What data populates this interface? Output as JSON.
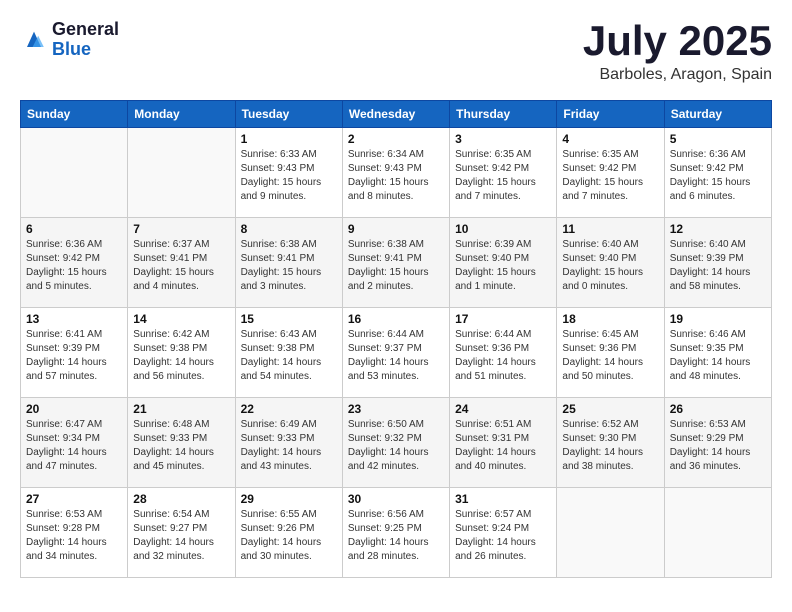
{
  "header": {
    "logo_general": "General",
    "logo_blue": "Blue",
    "month": "July 2025",
    "location": "Barboles, Aragon, Spain"
  },
  "days_of_week": [
    "Sunday",
    "Monday",
    "Tuesday",
    "Wednesday",
    "Thursday",
    "Friday",
    "Saturday"
  ],
  "weeks": [
    [
      {
        "day": "",
        "sunrise": "",
        "sunset": "",
        "daylight": ""
      },
      {
        "day": "",
        "sunrise": "",
        "sunset": "",
        "daylight": ""
      },
      {
        "day": "1",
        "sunrise": "Sunrise: 6:33 AM",
        "sunset": "Sunset: 9:43 PM",
        "daylight": "Daylight: 15 hours and 9 minutes."
      },
      {
        "day": "2",
        "sunrise": "Sunrise: 6:34 AM",
        "sunset": "Sunset: 9:43 PM",
        "daylight": "Daylight: 15 hours and 8 minutes."
      },
      {
        "day": "3",
        "sunrise": "Sunrise: 6:35 AM",
        "sunset": "Sunset: 9:42 PM",
        "daylight": "Daylight: 15 hours and 7 minutes."
      },
      {
        "day": "4",
        "sunrise": "Sunrise: 6:35 AM",
        "sunset": "Sunset: 9:42 PM",
        "daylight": "Daylight: 15 hours and 7 minutes."
      },
      {
        "day": "5",
        "sunrise": "Sunrise: 6:36 AM",
        "sunset": "Sunset: 9:42 PM",
        "daylight": "Daylight: 15 hours and 6 minutes."
      }
    ],
    [
      {
        "day": "6",
        "sunrise": "Sunrise: 6:36 AM",
        "sunset": "Sunset: 9:42 PM",
        "daylight": "Daylight: 15 hours and 5 minutes."
      },
      {
        "day": "7",
        "sunrise": "Sunrise: 6:37 AM",
        "sunset": "Sunset: 9:41 PM",
        "daylight": "Daylight: 15 hours and 4 minutes."
      },
      {
        "day": "8",
        "sunrise": "Sunrise: 6:38 AM",
        "sunset": "Sunset: 9:41 PM",
        "daylight": "Daylight: 15 hours and 3 minutes."
      },
      {
        "day": "9",
        "sunrise": "Sunrise: 6:38 AM",
        "sunset": "Sunset: 9:41 PM",
        "daylight": "Daylight: 15 hours and 2 minutes."
      },
      {
        "day": "10",
        "sunrise": "Sunrise: 6:39 AM",
        "sunset": "Sunset: 9:40 PM",
        "daylight": "Daylight: 15 hours and 1 minute."
      },
      {
        "day": "11",
        "sunrise": "Sunrise: 6:40 AM",
        "sunset": "Sunset: 9:40 PM",
        "daylight": "Daylight: 15 hours and 0 minutes."
      },
      {
        "day": "12",
        "sunrise": "Sunrise: 6:40 AM",
        "sunset": "Sunset: 9:39 PM",
        "daylight": "Daylight: 14 hours and 58 minutes."
      }
    ],
    [
      {
        "day": "13",
        "sunrise": "Sunrise: 6:41 AM",
        "sunset": "Sunset: 9:39 PM",
        "daylight": "Daylight: 14 hours and 57 minutes."
      },
      {
        "day": "14",
        "sunrise": "Sunrise: 6:42 AM",
        "sunset": "Sunset: 9:38 PM",
        "daylight": "Daylight: 14 hours and 56 minutes."
      },
      {
        "day": "15",
        "sunrise": "Sunrise: 6:43 AM",
        "sunset": "Sunset: 9:38 PM",
        "daylight": "Daylight: 14 hours and 54 minutes."
      },
      {
        "day": "16",
        "sunrise": "Sunrise: 6:44 AM",
        "sunset": "Sunset: 9:37 PM",
        "daylight": "Daylight: 14 hours and 53 minutes."
      },
      {
        "day": "17",
        "sunrise": "Sunrise: 6:44 AM",
        "sunset": "Sunset: 9:36 PM",
        "daylight": "Daylight: 14 hours and 51 minutes."
      },
      {
        "day": "18",
        "sunrise": "Sunrise: 6:45 AM",
        "sunset": "Sunset: 9:36 PM",
        "daylight": "Daylight: 14 hours and 50 minutes."
      },
      {
        "day": "19",
        "sunrise": "Sunrise: 6:46 AM",
        "sunset": "Sunset: 9:35 PM",
        "daylight": "Daylight: 14 hours and 48 minutes."
      }
    ],
    [
      {
        "day": "20",
        "sunrise": "Sunrise: 6:47 AM",
        "sunset": "Sunset: 9:34 PM",
        "daylight": "Daylight: 14 hours and 47 minutes."
      },
      {
        "day": "21",
        "sunrise": "Sunrise: 6:48 AM",
        "sunset": "Sunset: 9:33 PM",
        "daylight": "Daylight: 14 hours and 45 minutes."
      },
      {
        "day": "22",
        "sunrise": "Sunrise: 6:49 AM",
        "sunset": "Sunset: 9:33 PM",
        "daylight": "Daylight: 14 hours and 43 minutes."
      },
      {
        "day": "23",
        "sunrise": "Sunrise: 6:50 AM",
        "sunset": "Sunset: 9:32 PM",
        "daylight": "Daylight: 14 hours and 42 minutes."
      },
      {
        "day": "24",
        "sunrise": "Sunrise: 6:51 AM",
        "sunset": "Sunset: 9:31 PM",
        "daylight": "Daylight: 14 hours and 40 minutes."
      },
      {
        "day": "25",
        "sunrise": "Sunrise: 6:52 AM",
        "sunset": "Sunset: 9:30 PM",
        "daylight": "Daylight: 14 hours and 38 minutes."
      },
      {
        "day": "26",
        "sunrise": "Sunrise: 6:53 AM",
        "sunset": "Sunset: 9:29 PM",
        "daylight": "Daylight: 14 hours and 36 minutes."
      }
    ],
    [
      {
        "day": "27",
        "sunrise": "Sunrise: 6:53 AM",
        "sunset": "Sunset: 9:28 PM",
        "daylight": "Daylight: 14 hours and 34 minutes."
      },
      {
        "day": "28",
        "sunrise": "Sunrise: 6:54 AM",
        "sunset": "Sunset: 9:27 PM",
        "daylight": "Daylight: 14 hours and 32 minutes."
      },
      {
        "day": "29",
        "sunrise": "Sunrise: 6:55 AM",
        "sunset": "Sunset: 9:26 PM",
        "daylight": "Daylight: 14 hours and 30 minutes."
      },
      {
        "day": "30",
        "sunrise": "Sunrise: 6:56 AM",
        "sunset": "Sunset: 9:25 PM",
        "daylight": "Daylight: 14 hours and 28 minutes."
      },
      {
        "day": "31",
        "sunrise": "Sunrise: 6:57 AM",
        "sunset": "Sunset: 9:24 PM",
        "daylight": "Daylight: 14 hours and 26 minutes."
      },
      {
        "day": "",
        "sunrise": "",
        "sunset": "",
        "daylight": ""
      },
      {
        "day": "",
        "sunrise": "",
        "sunset": "",
        "daylight": ""
      }
    ]
  ]
}
